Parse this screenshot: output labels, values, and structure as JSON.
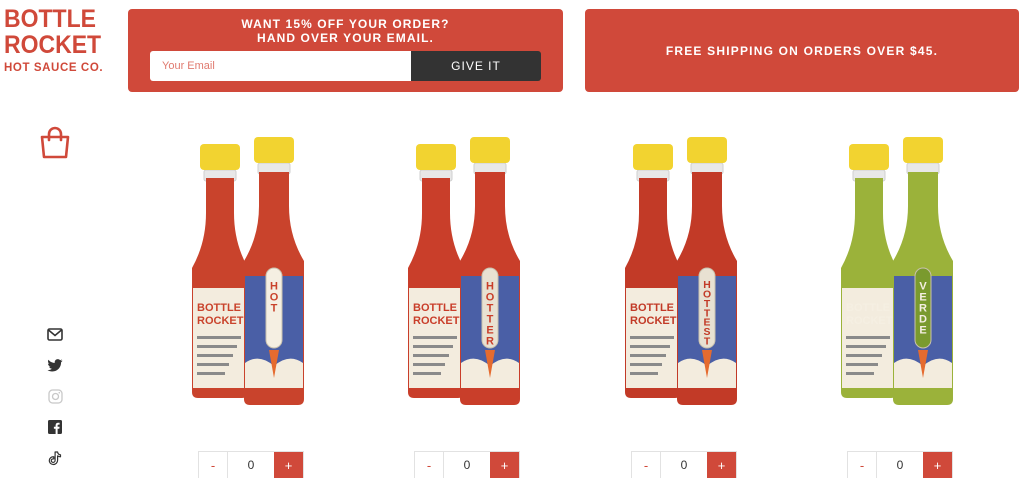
{
  "logo": {
    "line1": "BOTTLE",
    "line2": "ROCKET",
    "line3": "HOT SAUCE CO."
  },
  "promo": {
    "title_line1": "WANT 15% OFF YOUR ORDER?",
    "title_line2": "HAND OVER YOUR EMAIL.",
    "email_placeholder": "Your Email",
    "button_label": "GIVE IT"
  },
  "shipping": {
    "text": "FREE SHIPPING ON ORDERS OVER $45."
  },
  "icons": {
    "cart": "shopping-bag-icon",
    "social": [
      "mail-icon",
      "twitter-icon",
      "instagram-icon",
      "facebook-icon",
      "tiktok-icon"
    ]
  },
  "colors": {
    "accent": "#d0493a",
    "dark_button": "#333333"
  },
  "products": [
    {
      "label_small_brand": "BOTTLE ROCKET",
      "label_big": "HOT",
      "sauce_color": "#c9432c",
      "label_tube_color": "#f5efe2",
      "label_text_color": "#c9432c",
      "qty": "0",
      "minus": "-",
      "plus": "+"
    },
    {
      "label_small_brand": "BOTTLE ROCKET",
      "label_big": "HOTTER",
      "sauce_color": "#c93e2a",
      "label_tube_color": "#e8e1d2",
      "label_text_color": "#c93e2a",
      "qty": "0",
      "minus": "-",
      "plus": "+"
    },
    {
      "label_small_brand": "BOTTLE ROCKET",
      "label_big": "HOTTEST",
      "sauce_color": "#c23a27",
      "label_tube_color": "#e8e1d2",
      "label_text_color": "#c23a27",
      "qty": "0",
      "minus": "-",
      "plus": "+"
    },
    {
      "label_small_brand": "BOTTLE ROCKET",
      "label_big": "VERDE",
      "sauce_color": "#9bb23a",
      "label_tube_color": "#7a9a2e",
      "label_text_color": "#f5efe2",
      "qty": "0",
      "minus": "-",
      "plus": "+"
    }
  ]
}
